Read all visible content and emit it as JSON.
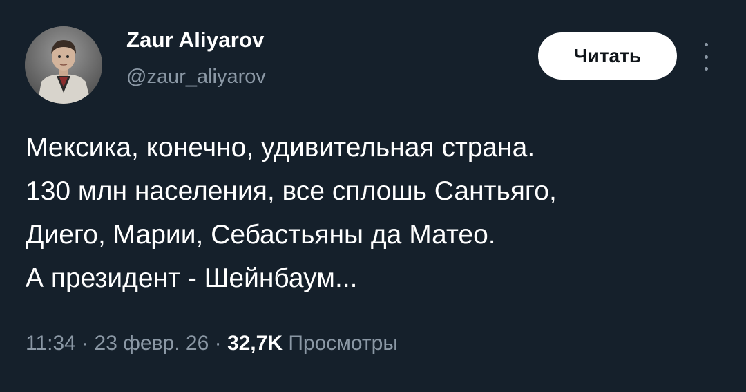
{
  "author": {
    "name": "Zaur Aliyarov",
    "handle": "@zaur_aliyarov"
  },
  "actions": {
    "follow_label": "Читать",
    "more_icon": "more-vertical-icon"
  },
  "tweet": {
    "lines": [
      "Мексика, конечно, удивительная страна.",
      "130 млн населения, все сплошь Сантьяго,",
      "Диего, Марии, Себастьяны да Матео.",
      "А президент - Шейнбаум..."
    ]
  },
  "meta": {
    "time": "11:34",
    "separator": "·",
    "date": "23 февр. 26",
    "views_count": "32,7K",
    "views_label": "Просмотры"
  },
  "colors": {
    "background": "#15202b",
    "text": "#ffffff",
    "secondary": "#8b98a5",
    "button_bg": "#ffffff",
    "button_text": "#0f1419"
  }
}
